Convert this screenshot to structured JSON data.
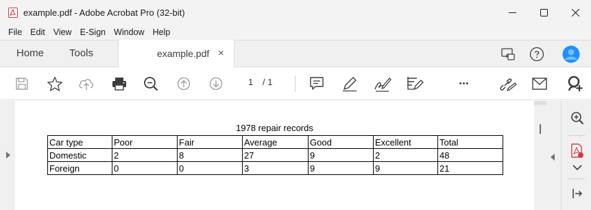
{
  "window": {
    "title": "example.pdf - Adobe Acrobat Pro (32-bit)",
    "app_icon": "acrobat-pdf-icon",
    "controls": [
      "minimize-icon",
      "maximize-icon",
      "close-icon"
    ]
  },
  "menu": {
    "items": [
      "File",
      "Edit",
      "View",
      "E-Sign",
      "Window",
      "Help"
    ]
  },
  "tabs": {
    "home": "Home",
    "tools": "Tools",
    "document": "example.pdf",
    "close_glyph": "×"
  },
  "tabbar_right_icons": [
    "share-screen-icon",
    "help-icon",
    "profile-avatar"
  ],
  "toolbar": {
    "page_current": "1",
    "page_total": "/ 1",
    "icons": [
      "save-icon",
      "bookmark-star-icon",
      "upload-cloud-icon",
      "print-icon",
      "zoom-icon",
      "page-up-icon",
      "page-down-icon",
      "comment-icon",
      "highlight-pen-icon",
      "sign-icon",
      "fill-form-icon",
      "more-icon",
      "share-link-icon",
      "email-icon",
      "add-user-icon"
    ],
    "more_glyph": "•••"
  },
  "document": {
    "caption": "1978 repair records",
    "table": {
      "headers": [
        "Car type",
        "Poor",
        "Fair",
        "Average",
        "Good",
        "Excellent",
        "Total"
      ],
      "rows": [
        [
          "Domestic",
          "2",
          "8",
          "27",
          "9",
          "2",
          "48"
        ],
        [
          "Foreign",
          "0",
          "0",
          "3",
          "9",
          "9",
          "21"
        ]
      ]
    }
  },
  "right_panel_icons": [
    "zoom-panel-icon",
    "export-pdf-icon",
    "chevron-down-icon",
    "collapse-panel-icon"
  ],
  "colors": {
    "acrobat_red": "#d7373f",
    "avatar_blue": "#1e90ff",
    "chrome_bg": "#f3f3f3",
    "icon_gray": "#6b6b6b"
  }
}
